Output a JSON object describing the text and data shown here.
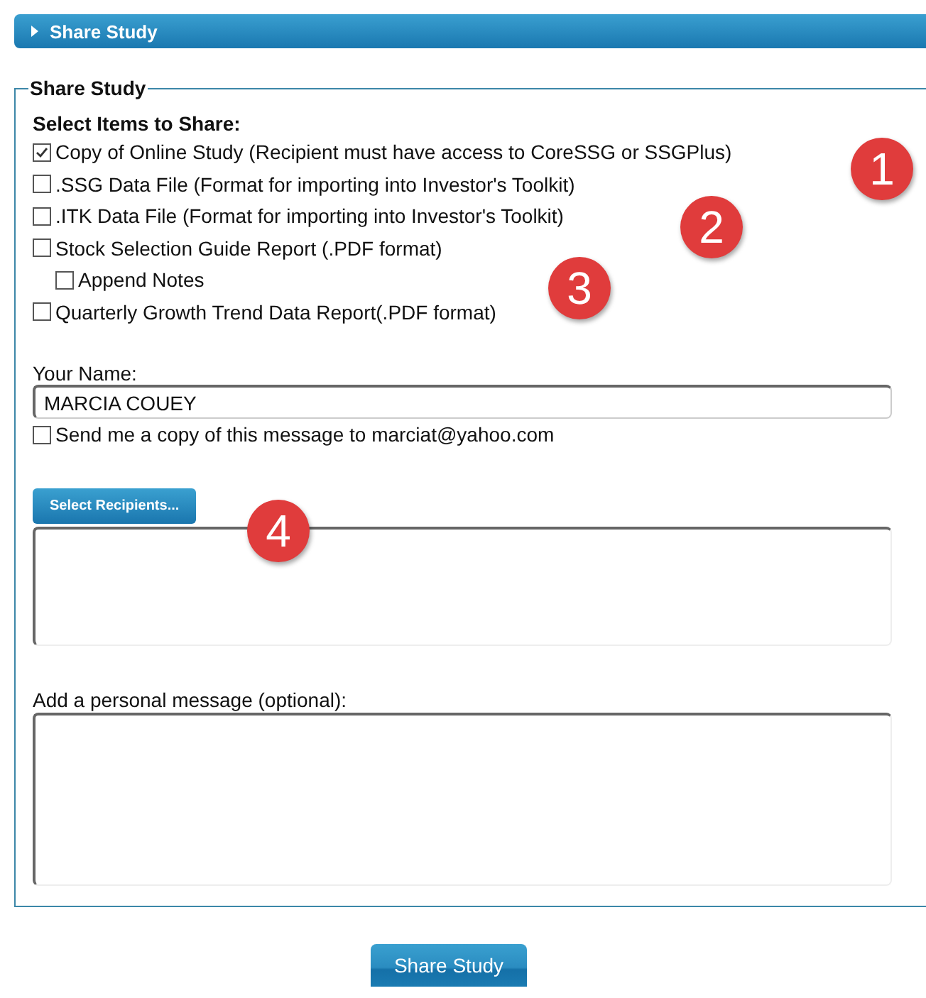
{
  "header": {
    "title": "Share Study",
    "expanded": false
  },
  "panel": {
    "legend": "Share Study",
    "items_heading": "Select Items to Share:",
    "items": [
      {
        "label": "Copy of Online Study (Recipient must have access to CoreSSG or SSGPlus)",
        "checked": true
      },
      {
        "label": ".SSG Data File (Format for importing into Investor's Toolkit)",
        "checked": false
      },
      {
        "label": ".ITK Data File (Format for importing into Investor's Toolkit)",
        "checked": false
      },
      {
        "label": "Stock Selection Guide Report (.PDF format)",
        "checked": false,
        "children": [
          {
            "label": "Append Notes",
            "checked": false
          }
        ]
      },
      {
        "label": "Quarterly Growth Trend Data Report(.PDF format)",
        "checked": false
      }
    ],
    "name_label": "Your Name:",
    "name_value": "MARCIA COUEY",
    "send_copy": {
      "label": "Send me a copy of this message to marciat@yahoo.com",
      "checked": false
    },
    "recipients_button": "Select Recipients...",
    "message_label": "Add a personal message (optional):"
  },
  "markers": [
    "1",
    "2",
    "3",
    "4"
  ],
  "submit_button": "Share Study"
}
